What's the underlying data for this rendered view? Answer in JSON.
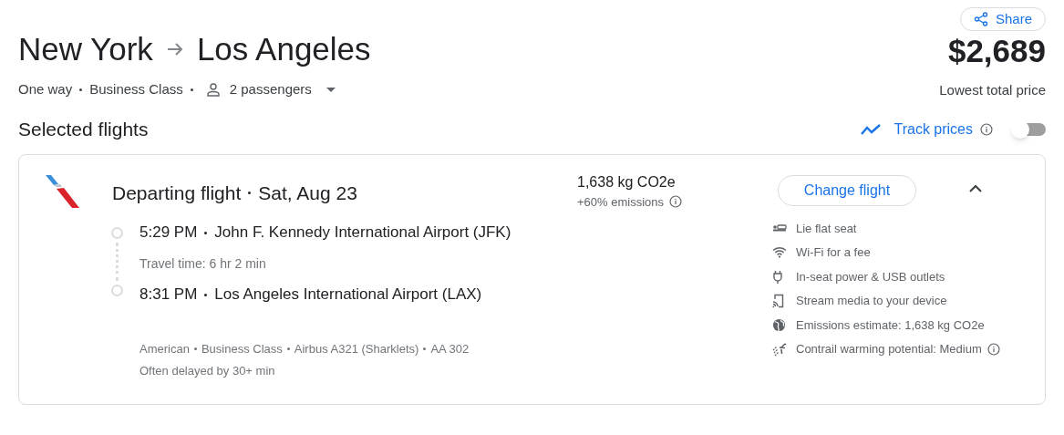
{
  "share_button": "Share",
  "route": {
    "origin": "New York",
    "destination": "Los Angeles"
  },
  "trip": {
    "type": "One way",
    "cabin": "Business Class",
    "passengers": "2 passengers"
  },
  "price": {
    "amount": "$2,689",
    "label": "Lowest total price"
  },
  "section_title": "Selected flights",
  "track_prices": {
    "label": "Track prices",
    "on": false
  },
  "flight": {
    "title": "Departing flight",
    "date": "Sat, Aug 23",
    "expanded": true,
    "emissions": "1,638 kg CO2e",
    "emissions_delta": "+60% emissions",
    "change_button": "Change flight",
    "departure": {
      "time": "5:29 PM",
      "airport": "John F. Kennedy International Airport (JFK)"
    },
    "travel_time": "Travel time: 6 hr 2 min",
    "arrival": {
      "time": "8:31 PM",
      "airport": "Los Angeles International Airport (LAX)"
    },
    "details": [
      "American",
      "Business Class",
      "Airbus A321 (Sharklets)",
      "AA 302"
    ],
    "delay_note": "Often delayed by 30+ min",
    "amenities": [
      {
        "kind": "seat",
        "label": "Lie flat seat"
      },
      {
        "kind": "wifi",
        "label": "Wi-Fi for a fee"
      },
      {
        "kind": "power",
        "label": "In-seat power & USB outlets"
      },
      {
        "kind": "stream",
        "label": "Stream media to your device"
      },
      {
        "kind": "emissions",
        "label": "Emissions estimate: 1,638 kg CO2e"
      },
      {
        "kind": "contrail",
        "label": "Contrail warming potential: Medium",
        "info": true
      }
    ]
  }
}
